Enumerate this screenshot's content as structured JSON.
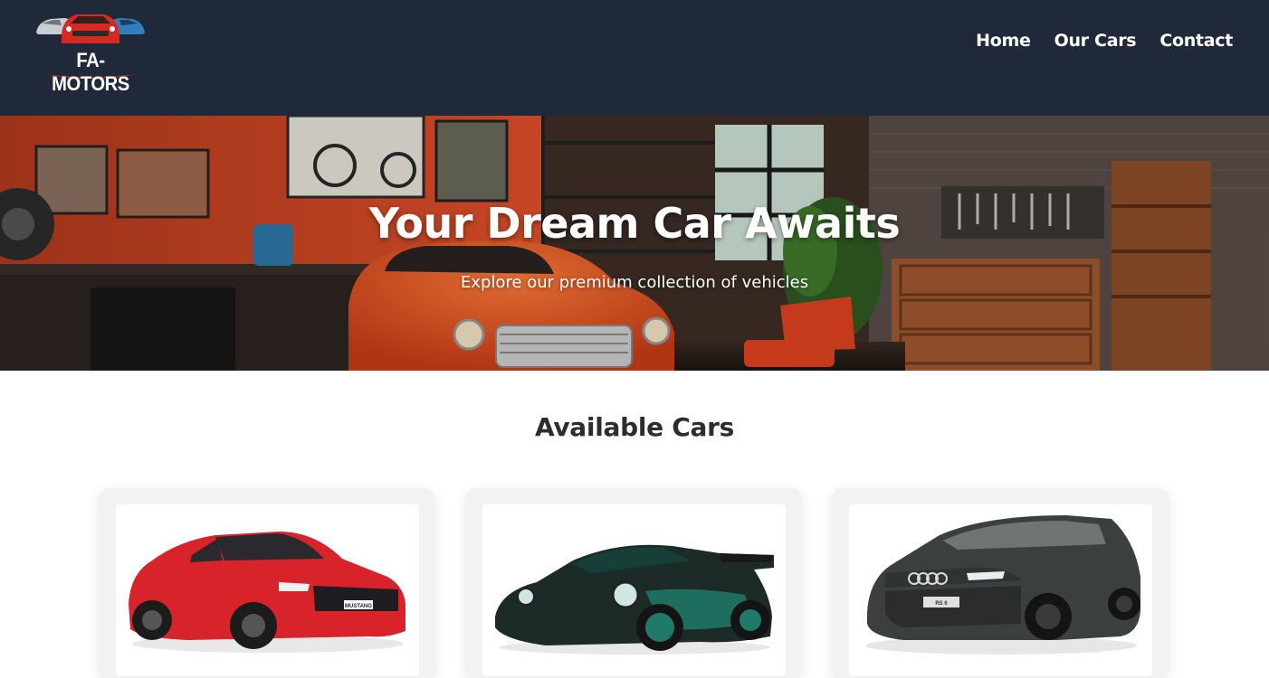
{
  "header": {
    "logo_text": "FA-MOTORS",
    "nav": [
      {
        "label": "Home"
      },
      {
        "label": "Our Cars"
      },
      {
        "label": "Contact"
      }
    ]
  },
  "hero": {
    "title": "Your Dream Car Awaits",
    "subtitle": "Explore our premium collection of vehicles"
  },
  "cars_section": {
    "title": "Available Cars",
    "cars": [
      {
        "image": "red-mustang-image",
        "plate": "MUSTANG",
        "color": "#d8232b"
      },
      {
        "image": "black-green-porsche-image",
        "color": "#1c2a28"
      },
      {
        "image": "grey-audi-wagon-image",
        "plate": "RS 6",
        "color": "#3b3f3d"
      }
    ]
  },
  "colors": {
    "header_bg": "#1f2939",
    "accent_red": "#c8201f"
  }
}
